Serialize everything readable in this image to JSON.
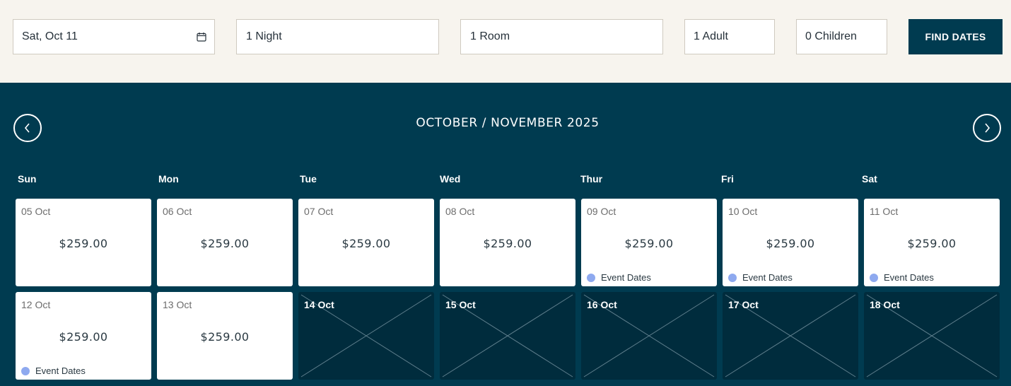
{
  "search": {
    "date": "Sat, Oct 11",
    "nights": "1 Night",
    "rooms": "1 Room",
    "adults": "1 Adult",
    "children": "0 Children",
    "find_label": "FIND DATES"
  },
  "calendar": {
    "title": "OCTOBER / NOVEMBER 2025",
    "weekdays": [
      "Sun",
      "Mon",
      "Tue",
      "Wed",
      "Thur",
      "Fri",
      "Sat"
    ],
    "days": [
      {
        "date": "05 Oct",
        "price": "$259.00",
        "event": ""
      },
      {
        "date": "06 Oct",
        "price": "$259.00",
        "event": ""
      },
      {
        "date": "07 Oct",
        "price": "$259.00",
        "event": ""
      },
      {
        "date": "08 Oct",
        "price": "$259.00",
        "event": ""
      },
      {
        "date": "09 Oct",
        "price": "$259.00",
        "event": "Event Dates"
      },
      {
        "date": "10 Oct",
        "price": "$259.00",
        "event": "Event Dates"
      },
      {
        "date": "11 Oct",
        "price": "$259.00",
        "event": "Event Dates"
      },
      {
        "date": "12 Oct",
        "price": "$259.00",
        "event": "Event Dates"
      },
      {
        "date": "13 Oct",
        "price": "$259.00",
        "event": ""
      },
      {
        "date": "14 Oct",
        "price": "",
        "event": ""
      },
      {
        "date": "15 Oct",
        "price": "",
        "event": ""
      },
      {
        "date": "16 Oct",
        "price": "",
        "event": ""
      },
      {
        "date": "17 Oct",
        "price": "",
        "event": ""
      },
      {
        "date": "18 Oct",
        "price": "",
        "event": ""
      }
    ]
  },
  "colors": {
    "brand": "#003b50",
    "unavailable": "#002c3d",
    "event_dot": "#8ea9ef",
    "top_background": "#f7f4ee"
  }
}
